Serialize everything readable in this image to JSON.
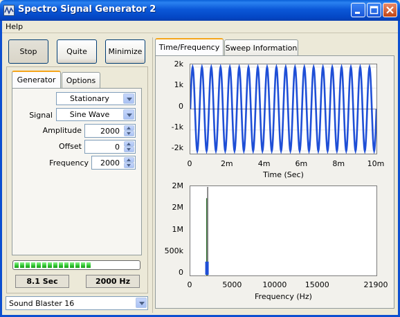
{
  "window": {
    "title": "Spectro Signal Generator 2"
  },
  "menu": {
    "help": "Help"
  },
  "buttons": {
    "stop": "Stop",
    "quite": "Quite",
    "minimize": "Minimize"
  },
  "left_tabs": [
    "Generator",
    "Options"
  ],
  "right_tabs": [
    "Time/Frequency",
    "Sweep Information"
  ],
  "generator": {
    "mode": "Stationary",
    "signal_label": "Signal",
    "signal": "Sine Wave",
    "amplitude_label": "Amplitude",
    "amplitude": "2000",
    "offset_label": "Offset",
    "offset": "0",
    "frequency_label": "Frequency",
    "frequency": "2000"
  },
  "status": {
    "progress_fraction": 0.65,
    "time": "8.1 Sec",
    "freq": "2000 Hz"
  },
  "device": {
    "selected": "Sound Blaster 16"
  },
  "colors": {
    "trace": "#1f4fd6",
    "spectrum_line": "#2a6d2a",
    "progress": "#30c430"
  },
  "chart_data": [
    {
      "type": "line",
      "xlabel": "Time (Sec)",
      "ylabel": "",
      "x_ticks": [
        "0",
        "2m",
        "4m",
        "6m",
        "8m",
        "10m"
      ],
      "y_ticks": [
        "2k",
        "1k",
        "0",
        "-1k",
        "-2k"
      ],
      "xlim": [
        0,
        10
      ],
      "ylim": [
        -2000,
        2000
      ],
      "x_unit": "ms",
      "amplitude": 2000,
      "frequency_hz": 2000,
      "cycles_shown": 20
    },
    {
      "type": "line",
      "xlabel": "Frequency (Hz)",
      "ylabel": "",
      "x_ticks": [
        "0",
        "5000",
        "10000",
        "15000",
        "21900"
      ],
      "y_ticks": [
        "2M",
        "2M",
        "1M",
        "500k",
        "0"
      ],
      "xlim": [
        0,
        21900
      ],
      "ylim": [
        0,
        2000000
      ],
      "peak": {
        "frequency": 2000,
        "magnitude": 1800000
      }
    }
  ]
}
